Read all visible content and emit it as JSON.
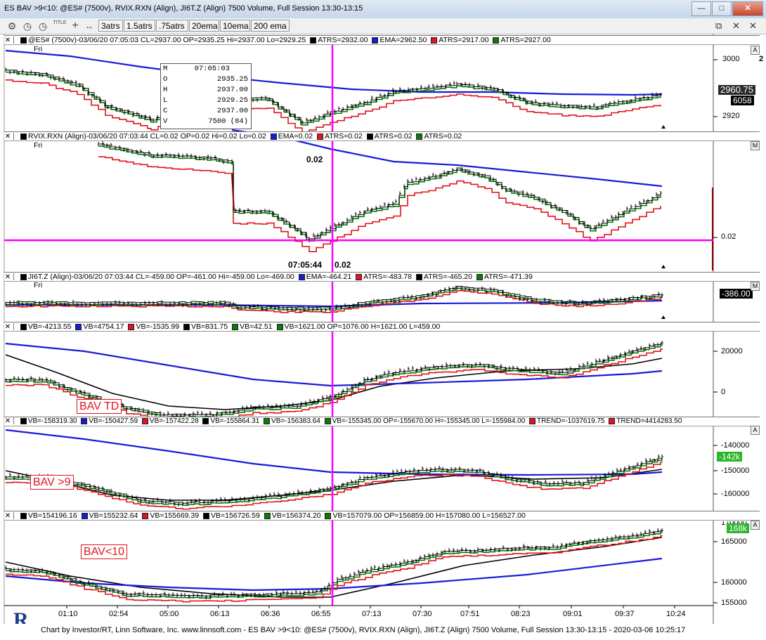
{
  "window": {
    "title": "ES BAV  >9<10: @ES# (7500v), RVIX.RXN (Align), JI6T.Z (Align) 7500 Volume, Full Session 13:30-13:15",
    "buttons": [
      "minimize",
      "maximize",
      "close"
    ]
  },
  "toolbar": {
    "icons": [
      "gear-icon",
      "timer-icon",
      "clock-icon",
      "title-icon",
      "crosshair-icon",
      "scroll-icon"
    ],
    "title_label": "TITLE",
    "buttons": [
      "3atrs",
      "1.5atrs",
      ".75atrs",
      "20ema",
      "10ema",
      "200 ema"
    ],
    "right_icons": [
      "restore-icon",
      "close-icon"
    ]
  },
  "panes": {
    "es": {
      "header": "@ES# (7500v)-03/06/20 07:05:03 CL=2937.00 OP=2935.25 Hi=2937.00 Lo=2929.25",
      "legend": [
        "ATRS=2932.00",
        "EMA=2962.50",
        "ATRS=2917.00",
        "ATRS=2927.00"
      ],
      "day": "Fri",
      "axis": [
        "3000",
        "2920"
      ],
      "last_price": "2960.75",
      "volume": "6058",
      "axis_label_partial": "2"
    },
    "rvix": {
      "header": "RVIX.RXN (Align)-03/06/20 07:03:44 CL=0.02 OP=0.02 Hi=0.02 Lo=0.02",
      "legend": [
        "EMA=0.02",
        "ATRS=0.02",
        "ATRS=0.02",
        "ATRS=0.02"
      ],
      "day": "Fri",
      "top_value": "0.02",
      "cursor_time": "07:05:44",
      "cursor_value": "0.02",
      "axis": [
        "0.02"
      ]
    },
    "ji6t": {
      "header": "JI6T.Z (Align)-03/06/20 07:03:44 CL=-459.00 OP=-461.00 Hi=-459.00 Lo=-469.00",
      "legend": [
        "EMA=-464.21",
        "ATRS=-483.78",
        "ATRS=-465.20",
        "ATRS=-471.39"
      ],
      "day": "Fri",
      "last": "-386.00"
    },
    "bavtd": {
      "header": [
        "VB=-4213.55",
        "VB=4754.17",
        "VB=-1535.99",
        "VB=831.75",
        "VB=42.51",
        "VB=1621.00 OP=1076.00 H=1621.00 L=459.00"
      ],
      "annotation": "BAV TD",
      "axis": [
        "20000",
        "0"
      ]
    },
    "bav9": {
      "header": [
        "VB=-158319.30",
        "VB=-150427.59",
        "VB=-157422.28",
        "VB=-155864.31",
        "VB=-156383.64",
        "VB=-155345.00 OP=-155670.00 H=-155345.00 L=-155984.00",
        "TREND=-1037619.75",
        "TREND=4414283.50"
      ],
      "annotation": "BAV >9",
      "axis": [
        "-140000",
        "-150000",
        "-160000"
      ],
      "last": "-142k"
    },
    "bav10": {
      "header": [
        "VB=154196.16",
        "VB=155232.64",
        "VB=155669.39",
        "VB=156726.59",
        "VB=156374.20",
        "VB=157079.00 OP=156859.00 H=157080.00 L=156527.00"
      ],
      "annotation": "BAV<10",
      "axis": [
        "165000",
        "160000",
        "155000"
      ],
      "last": "168k",
      "axis_partial": "170000"
    }
  },
  "ohlc_box": {
    "rows": [
      {
        "k": "M",
        "v": "07:05:03"
      },
      {
        "k": "O",
        "v": "2935.25"
      },
      {
        "k": "H",
        "v": "2937.00"
      },
      {
        "k": "L",
        "v": "2929.25"
      },
      {
        "k": "C",
        "v": "2937.00"
      },
      {
        "k": "V",
        "v": "7500 (84)"
      }
    ]
  },
  "time_axis": [
    "01:10",
    "02:54",
    "05:00",
    "06:13",
    "06:36",
    "06:55",
    "07:13",
    "07:30",
    "07:51",
    "08:23",
    "09:01",
    "09:37",
    "10:24"
  ],
  "pane_buttons": {
    "a": "A",
    "m": "M"
  },
  "footer": "Chart by Investor/RT, Linn Software, Inc. www.linnsoft.com - ES BAV  >9<10: @ES# (7500v), RVIX.RXN (Align), JI6T.Z (Align) 7500 Volume, Full Session 13:30-13:15 - 2020-03-06 10:25:17",
  "logo": "R",
  "colors": {
    "ema_blue": "#1a1ad8",
    "atrs_red": "#e0141e",
    "atrs_green": "#0a7a0a",
    "black": "#000000",
    "cursor_magenta": "#ff00ff"
  }
}
